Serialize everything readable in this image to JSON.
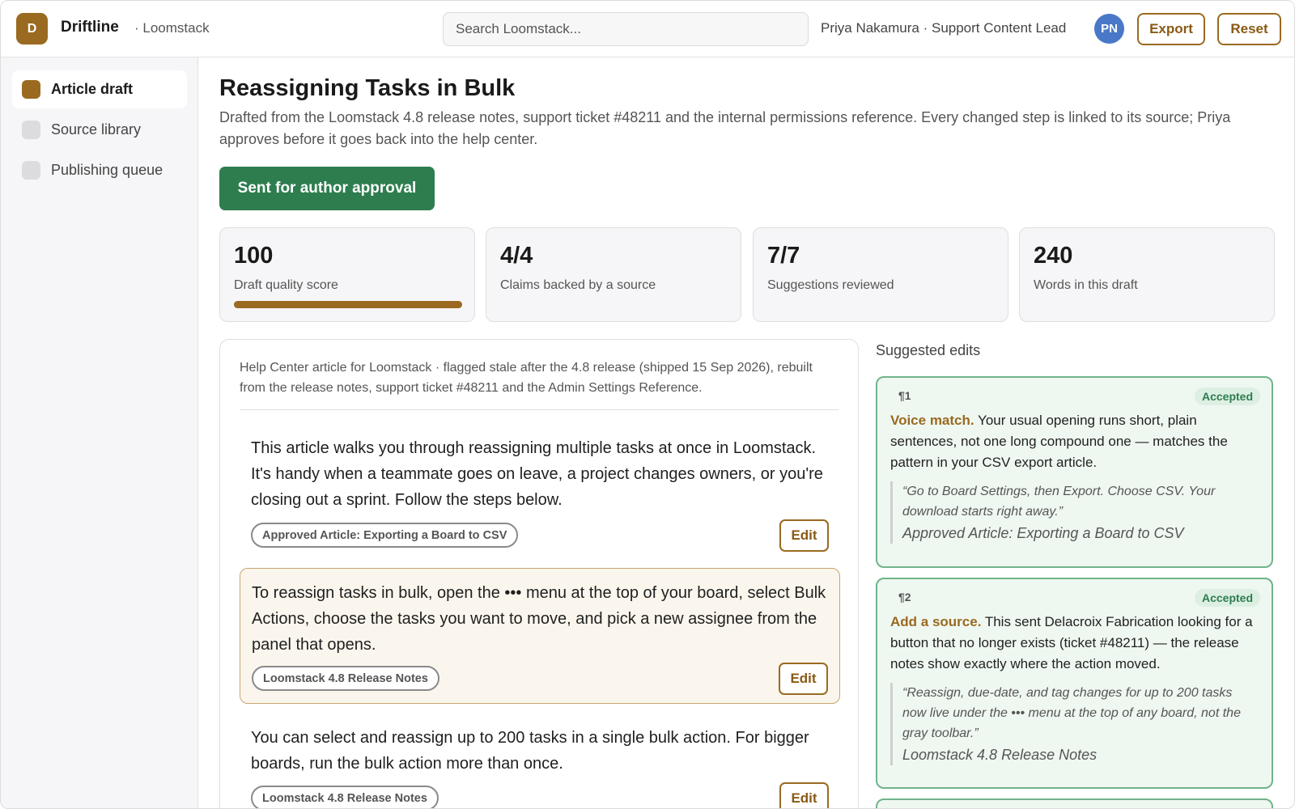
{
  "header": {
    "logo_letter": "D",
    "app_name": "Driftline",
    "workspace": "· Loomstack",
    "search_placeholder": "Search Loomstack...",
    "user": "Priya Nakamura · Support Content Lead",
    "avatar_initials": "PN",
    "export_label": "Export",
    "reset_label": "Reset"
  },
  "sidebar": {
    "items": [
      {
        "label": "Article draft"
      },
      {
        "label": "Source library"
      },
      {
        "label": "Publishing queue"
      }
    ]
  },
  "main": {
    "title": "Reassigning Tasks in Bulk",
    "intro": "Drafted from the Loomstack 4.8 release notes, support ticket #48211 and the internal permissions reference. Every changed step is linked to its source; Priya approves before it goes back into the help center.",
    "status_label": "Sent for author approval",
    "stats": [
      {
        "value": "100",
        "label": "Draft quality score",
        "progress": 1.0
      },
      {
        "value": "4/4",
        "label": "Claims backed by a source"
      },
      {
        "value": "7/7",
        "label": "Suggestions reviewed"
      },
      {
        "value": "240",
        "label": "Words in this draft"
      }
    ]
  },
  "article": {
    "header": "Help Center article for Loomstack · flagged stale after the 4.8 release (shipped 15 Sep 2026), rebuilt from the release notes, support ticket #48211 and the Admin Settings Reference.",
    "edit_label": "Edit",
    "paragraphs": [
      {
        "text": "This article walks you through reassigning multiple tasks at once in Loomstack. It's handy when a teammate goes on leave, a project changes owners, or you're closing out a sprint. Follow the steps below.",
        "source": "Approved Article: Exporting a Board to CSV"
      },
      {
        "text": "To reassign tasks in bulk, open the ••• menu at the top of your board, select Bulk Actions, choose the tasks you want to move, and pick a new assignee from the panel that opens.",
        "source": "Loomstack 4.8 Release Notes"
      },
      {
        "text": "You can select and reassign up to 200 tasks in a single bulk action. For bigger boards, run the bulk action more than once.",
        "source": "Loomstack 4.8 Release Notes"
      }
    ]
  },
  "suggestions": {
    "title": "Suggested edits",
    "items": [
      {
        "para": "¶1",
        "status": "Accepted",
        "kind": "Voice match.",
        "text": " Your usual opening runs short, plain sentences, not one long compound one — matches the pattern in your CSV export article.",
        "quote": "“Go to Board Settings, then Export. Choose CSV. Your download starts right away.”",
        "source": "Approved Article: Exporting a Board to CSV"
      },
      {
        "para": "¶2",
        "status": "Accepted",
        "kind": "Add a source.",
        "text": " This sent Delacroix Fabrication looking for a button that no longer exists (ticket #48211) — the release notes show exactly where the action moved.",
        "quote": "“Reassign, due-date, and tag changes for up to 200 tasks now live under the ••• menu at the top of any board, not the gray toolbar.”",
        "source": "Loomstack 4.8 Release Notes"
      }
    ]
  }
}
